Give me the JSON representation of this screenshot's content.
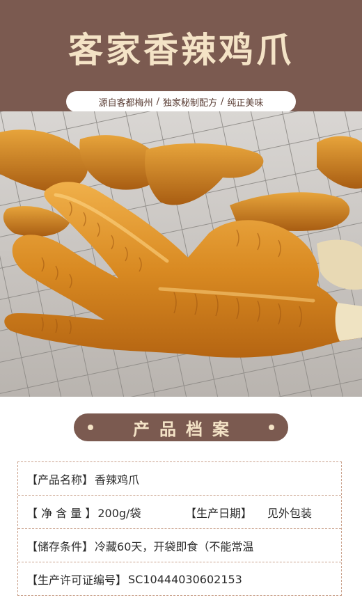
{
  "banner": {
    "title": "客家香辣鸡爪",
    "tags": [
      "源自客都梅州",
      "独家秘制配方",
      "纯正美味"
    ],
    "sep1": "/",
    "sep2": "/"
  },
  "colors": {
    "brand_brown": "#7b5a50",
    "cream": "#f4e3c6",
    "dashed_border": "#c9a08a"
  },
  "section": {
    "label": "产品档案"
  },
  "product": {
    "name_key": "【产品名称】",
    "name_val": "香辣鸡爪",
    "weight_key": "【 净 含 量 】",
    "weight_val": "200g/袋",
    "date_key": "【生产日期】",
    "date_val": "见外包装",
    "storage_key": "【储存条件】",
    "storage_val": "冷藏60天，开袋即食（不能常温",
    "license_key": "【生产许可证编号】",
    "license_val": "SC10444030602153"
  }
}
